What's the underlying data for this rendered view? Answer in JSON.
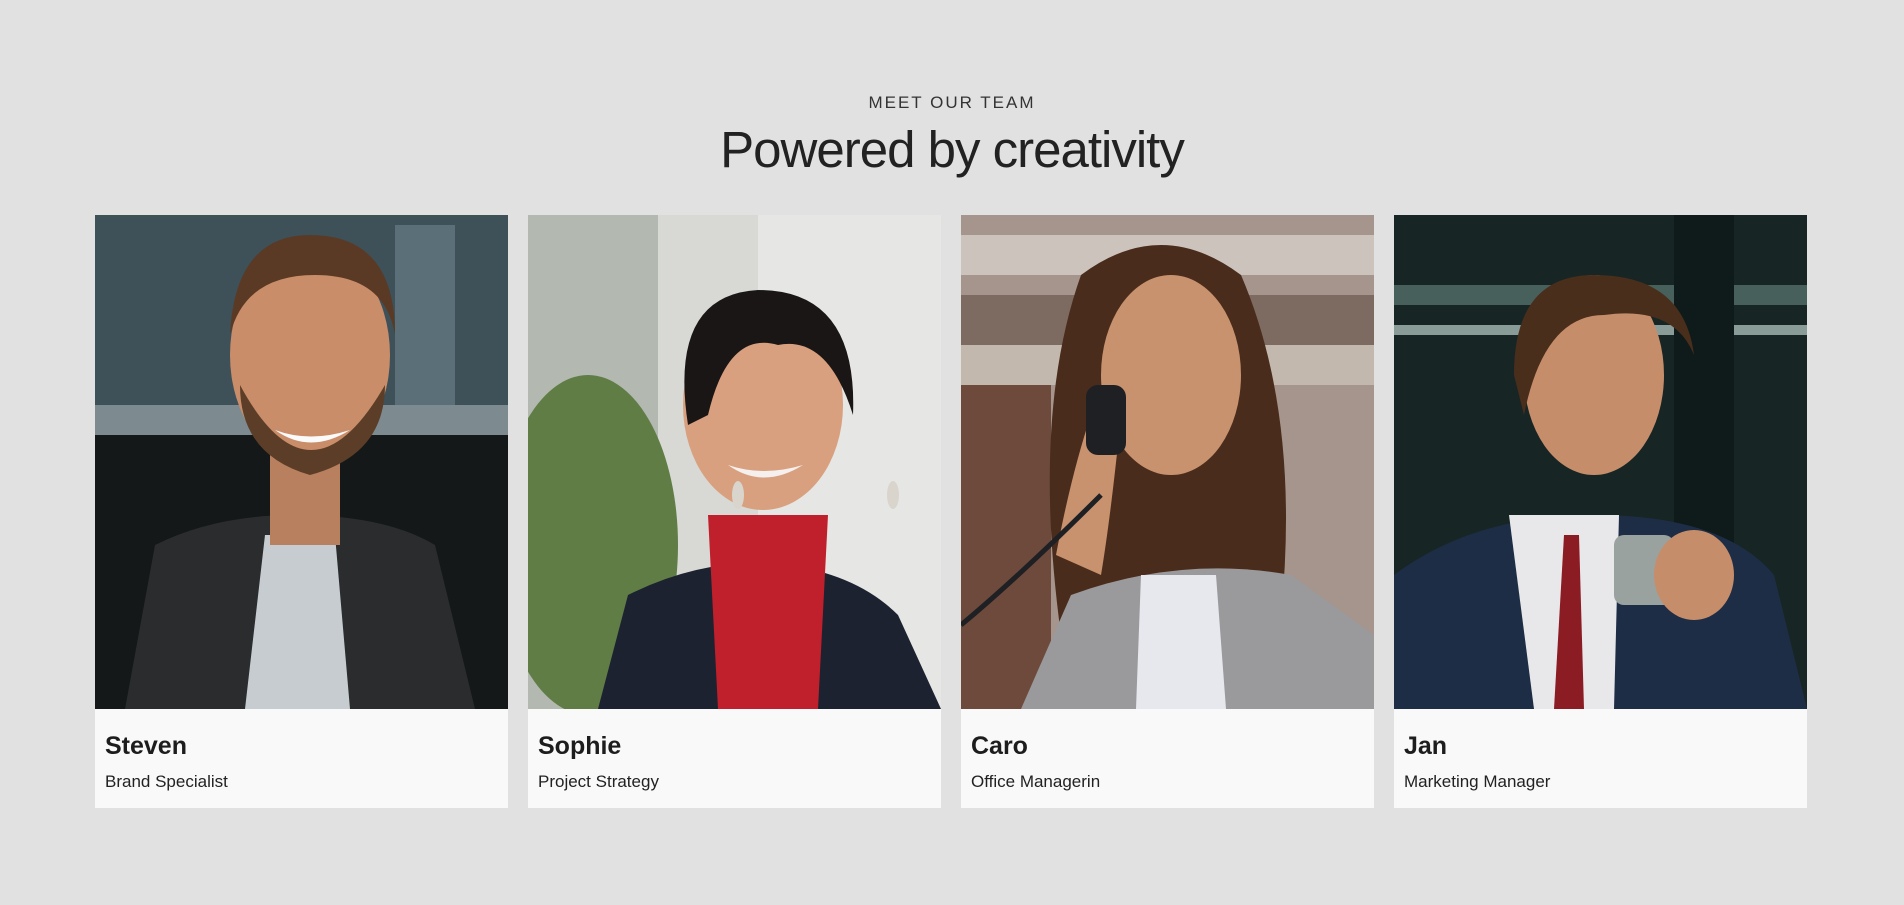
{
  "header": {
    "eyebrow": "MEET OUR TEAM",
    "title": "Powered by creativity"
  },
  "team": [
    {
      "name": "Steven",
      "role": "Brand Specialist",
      "photo": "portrait-smiling-man-dark-jacket",
      "colors": {
        "bg1": "#3a4a52",
        "bg2": "#1a1f22",
        "skin": "#c98d6a",
        "hair": "#5a3a24",
        "cloth": "#2a2c2e",
        "shirt": "#c7ccd0"
      }
    },
    {
      "name": "Sophie",
      "role": "Project Strategy",
      "photo": "portrait-woman-red-scarf",
      "colors": {
        "bg1": "#d8d8d4",
        "bg2": "#6f8a52",
        "skin": "#d8a07e",
        "hair": "#1b1616",
        "cloth": "#1c2230",
        "shirt": "#c0202c"
      }
    },
    {
      "name": "Caro",
      "role": "Office Managerin",
      "photo": "portrait-woman-on-phone",
      "colors": {
        "bg1": "#b7a79c",
        "bg2": "#6d4a3c",
        "skin": "#c8926e",
        "hair": "#4a2c1c",
        "cloth": "#9a9a9c",
        "shirt": "#e6e8ee"
      }
    },
    {
      "name": "Jan",
      "role": "Marketing Manager",
      "photo": "portrait-man-coffee-cup",
      "colors": {
        "bg1": "#27403c",
        "bg2": "#0f1a1a",
        "skin": "#c68d6a",
        "hair": "#4a2e1c",
        "cloth": "#1e2d46",
        "shirt": "#e8e8ea"
      }
    }
  ]
}
